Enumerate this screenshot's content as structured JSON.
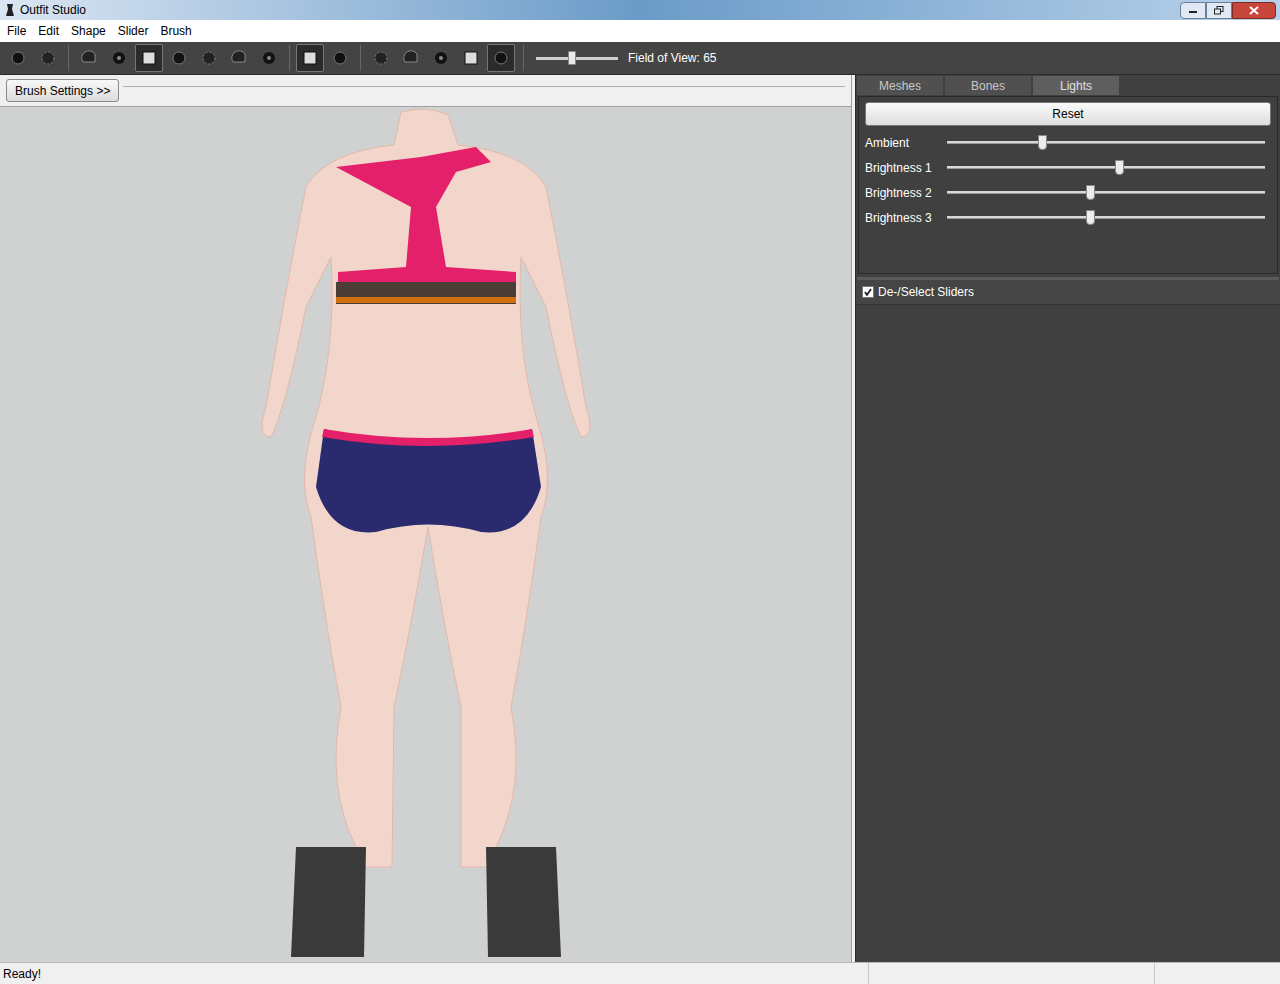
{
  "window": {
    "title": "Outfit Studio"
  },
  "menu": [
    "File",
    "Edit",
    "Shape",
    "Slider",
    "Brush"
  ],
  "toolbar": {
    "groups": [
      [
        {
          "selected": false
        },
        {
          "selected": false
        }
      ],
      [
        {
          "selected": false
        },
        {
          "selected": false
        },
        {
          "selected": true
        },
        {
          "selected": false
        },
        {
          "selected": false
        },
        {
          "selected": false
        },
        {
          "selected": false
        }
      ],
      [
        {
          "selected": true
        },
        {
          "selected": false
        }
      ],
      [
        {
          "selected": false
        },
        {
          "selected": false
        },
        {
          "selected": false
        },
        {
          "selected": false
        },
        {
          "selected": true
        }
      ]
    ],
    "fov": {
      "level": 0.44,
      "label": "Field of View: 65"
    }
  },
  "brush_settings": {
    "label": "Brush Settings >>"
  },
  "panel": {
    "tabs": [
      {
        "label": "Meshes",
        "selected": false
      },
      {
        "label": "Bones",
        "selected": false
      },
      {
        "label": "Lights",
        "selected": true
      }
    ],
    "reset": "Reset",
    "lights": [
      {
        "label": "Ambient",
        "level": 0.3
      },
      {
        "label": "Brightness 1",
        "level": 0.54
      },
      {
        "label": "Brightness 2",
        "level": 0.45
      },
      {
        "label": "Brightness 3",
        "level": 0.45
      }
    ],
    "select_sliders": {
      "label": "De-/Select Sliders",
      "checked": true
    }
  },
  "status_bar": "Ready!"
}
